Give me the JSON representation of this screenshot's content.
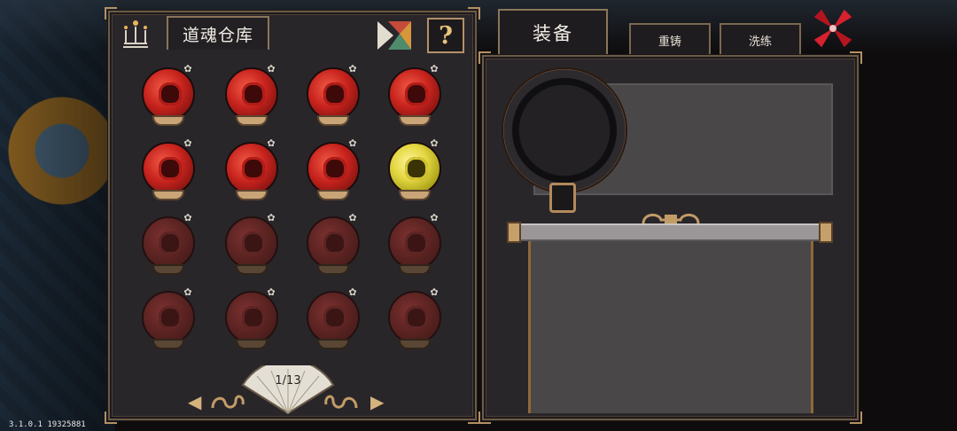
{
  "version": "3.1.0.1 19325881",
  "left_panel": {
    "title": "道魂仓库",
    "help_label": "?",
    "icons": {
      "header": "candelabra-icon",
      "sort": "color-sort-icon"
    },
    "grid": [
      [
        "red",
        "red",
        "red",
        "red"
      ],
      [
        "red",
        "red",
        "red",
        "gold"
      ],
      [
        "dim",
        "dim",
        "dim",
        "dim"
      ],
      [
        "dim",
        "dim",
        "dim",
        "dim"
      ]
    ],
    "pagination": {
      "label": "1/13",
      "prev": "◀",
      "next": "▶"
    }
  },
  "right_panel": {
    "tabs": {
      "main": "装备",
      "recast": "重铸",
      "refine": "洗练"
    }
  },
  "colors": {
    "accent": "#b59163",
    "orb_red": "#c7231d",
    "orb_gold": "#e4d640",
    "close": "#d7212c"
  }
}
